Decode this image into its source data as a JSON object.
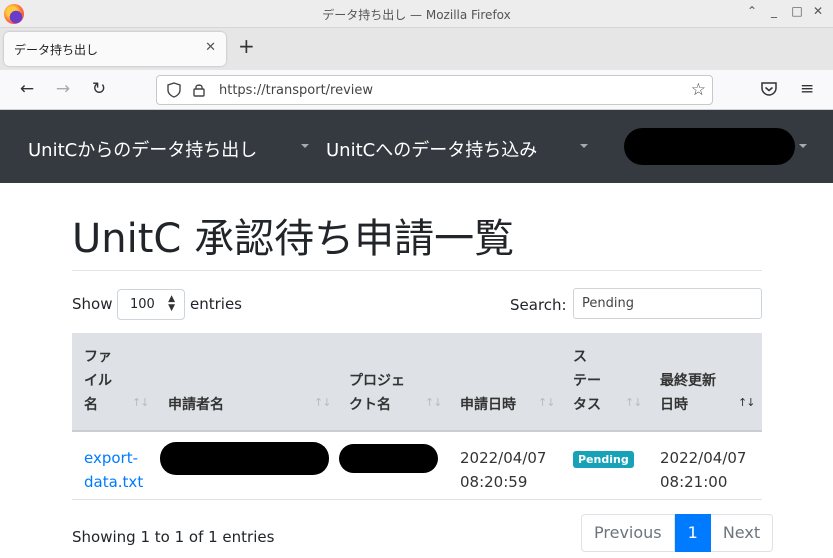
{
  "window": {
    "title": "データ持ち出し — Mozilla Firefox"
  },
  "tab": {
    "label": "データ持ち出し"
  },
  "urlbar": {
    "url": "https://transport/review"
  },
  "appnav": {
    "item1": "UnitCからのデータ持ち出し",
    "item2": "UnitCへのデータ持ち込み"
  },
  "page": {
    "title": "UnitC 承認待ち申請一覧"
  },
  "table_controls": {
    "show_label": "Show",
    "page_length": "100",
    "entries_label": "entries",
    "search_label": "Search:",
    "search_value": "Pending"
  },
  "table": {
    "columns": [
      {
        "lines": [
          "ファ",
          "イル",
          "名"
        ]
      },
      {
        "lines": [
          "申請者名"
        ]
      },
      {
        "lines": [
          "プロジェ",
          "クト名"
        ]
      },
      {
        "lines": [
          "申請日時"
        ]
      },
      {
        "lines": [
          "ス",
          "テー",
          "タス"
        ]
      },
      {
        "lines": [
          "最終更新",
          "日時"
        ]
      }
    ],
    "rows": [
      {
        "file_name": [
          "export-",
          "data.txt"
        ],
        "submitted": [
          "2022/04/07",
          "08:20:59"
        ],
        "status": "Pending",
        "updated": [
          "2022/04/07",
          "08:21:00"
        ]
      }
    ]
  },
  "footer": {
    "info": "Showing 1 to 1 of 1 entries",
    "prev": "Previous",
    "page": "1",
    "next": "Next"
  },
  "colors": {
    "navbar_bg": "#343a40",
    "link": "#007bff",
    "badge": "#17a2b8",
    "header_bg": "#dee2e6"
  }
}
